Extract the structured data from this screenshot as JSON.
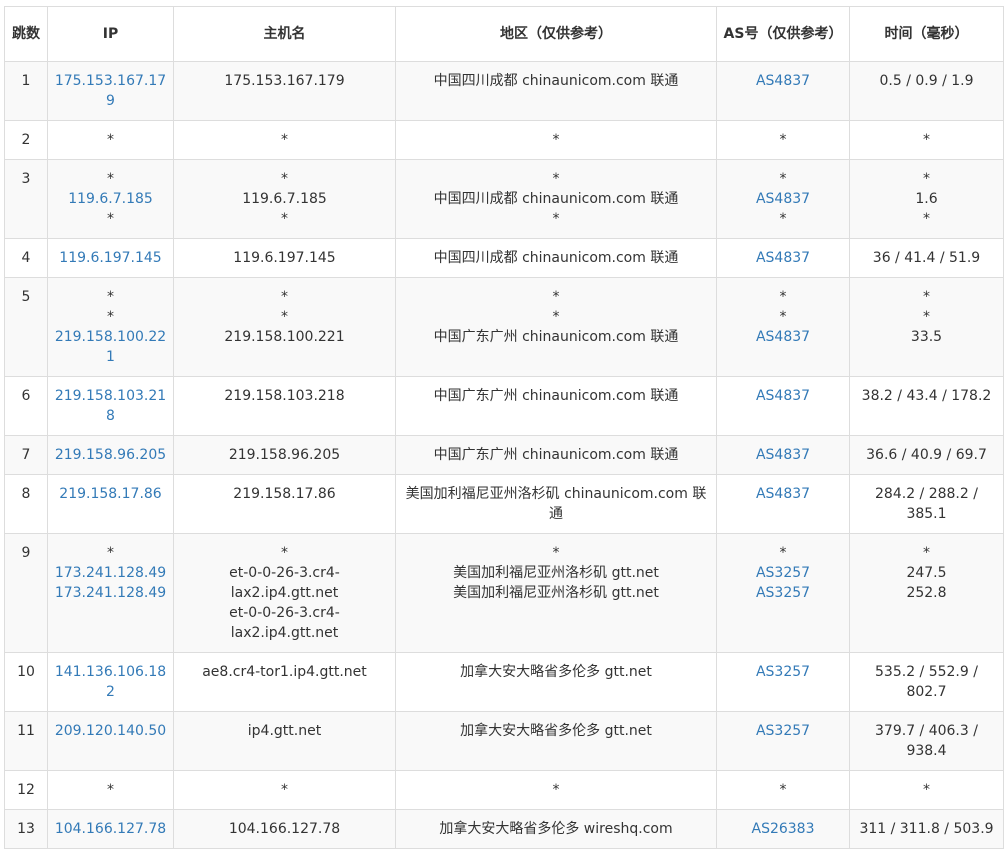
{
  "headers": [
    "跳数",
    "IP",
    "主机名",
    "地区（仅供参考）",
    "AS号（仅供参考）",
    "时间（毫秒）"
  ],
  "rows": [
    {
      "hop": "1",
      "ip": [
        "175.153.167.179"
      ],
      "host": [
        "175.153.167.179"
      ],
      "region": [
        "中国四川成都 chinaunicom.com 联通"
      ],
      "as": [
        "AS4837"
      ],
      "time": [
        "0.5 / 0.9 / 1.9"
      ]
    },
    {
      "hop": "2",
      "ip": [
        "*"
      ],
      "host": [
        "*"
      ],
      "region": [
        "*"
      ],
      "as": [
        "*"
      ],
      "time": [
        "*"
      ]
    },
    {
      "hop": "3",
      "ip": [
        "*",
        "119.6.7.185",
        "*"
      ],
      "host": [
        "*",
        "119.6.7.185",
        "*"
      ],
      "region": [
        "*",
        "中国四川成都 chinaunicom.com 联通",
        "*"
      ],
      "as": [
        "*",
        "AS4837",
        "*"
      ],
      "time": [
        "*",
        "1.6",
        "*"
      ]
    },
    {
      "hop": "4",
      "ip": [
        "119.6.197.145"
      ],
      "host": [
        "119.6.197.145"
      ],
      "region": [
        "中国四川成都 chinaunicom.com 联通"
      ],
      "as": [
        "AS4837"
      ],
      "time": [
        "36 / 41.4 / 51.9"
      ]
    },
    {
      "hop": "5",
      "ip": [
        "*",
        "*",
        "219.158.100.221"
      ],
      "host": [
        "*",
        "*",
        "219.158.100.221"
      ],
      "region": [
        "*",
        "*",
        "中国广东广州 chinaunicom.com 联通"
      ],
      "as": [
        "*",
        "*",
        "AS4837"
      ],
      "time": [
        "*",
        "*",
        "33.5"
      ]
    },
    {
      "hop": "6",
      "ip": [
        "219.158.103.218"
      ],
      "host": [
        "219.158.103.218"
      ],
      "region": [
        "中国广东广州 chinaunicom.com 联通"
      ],
      "as": [
        "AS4837"
      ],
      "time": [
        "38.2 / 43.4 / 178.2"
      ]
    },
    {
      "hop": "7",
      "ip": [
        "219.158.96.205"
      ],
      "host": [
        "219.158.96.205"
      ],
      "region": [
        "中国广东广州 chinaunicom.com 联通"
      ],
      "as": [
        "AS4837"
      ],
      "time": [
        "36.6 / 40.9 / 69.7"
      ]
    },
    {
      "hop": "8",
      "ip": [
        "219.158.17.86"
      ],
      "host": [
        "219.158.17.86"
      ],
      "region": [
        "美国加利福尼亚州洛杉矶 chinaunicom.com 联通"
      ],
      "as": [
        "AS4837"
      ],
      "time": [
        "284.2 / 288.2 / 385.1"
      ]
    },
    {
      "hop": "9",
      "ip": [
        "*",
        "173.241.128.49",
        "173.241.128.49"
      ],
      "host": [
        "*",
        "et-0-0-26-3.cr4-lax2.ip4.gtt.net",
        "et-0-0-26-3.cr4-lax2.ip4.gtt.net"
      ],
      "region": [
        "*",
        "美国加利福尼亚州洛杉矶 gtt.net",
        "美国加利福尼亚州洛杉矶 gtt.net"
      ],
      "as": [
        "*",
        "AS3257",
        "AS3257"
      ],
      "time": [
        "*",
        "247.5",
        "252.8"
      ]
    },
    {
      "hop": "10",
      "ip": [
        "141.136.106.182"
      ],
      "host": [
        "ae8.cr4-tor1.ip4.gtt.net"
      ],
      "region": [
        "加拿大安大略省多伦多 gtt.net"
      ],
      "as": [
        "AS3257"
      ],
      "time": [
        "535.2 / 552.9 / 802.7"
      ]
    },
    {
      "hop": "11",
      "ip": [
        "209.120.140.50"
      ],
      "host": [
        "ip4.gtt.net"
      ],
      "region": [
        "加拿大安大略省多伦多 gtt.net"
      ],
      "as": [
        "AS3257"
      ],
      "time": [
        "379.7 / 406.3 / 938.4"
      ]
    },
    {
      "hop": "12",
      "ip": [
        "*"
      ],
      "host": [
        "*"
      ],
      "region": [
        "*"
      ],
      "as": [
        "*"
      ],
      "time": [
        "*"
      ]
    },
    {
      "hop": "13",
      "ip": [
        "104.166.127.78"
      ],
      "host": [
        "104.166.127.78"
      ],
      "region": [
        "加拿大安大略省多伦多 wireshq.com"
      ],
      "as": [
        "AS26383"
      ],
      "time": [
        "311 / 311.8 / 503.9"
      ]
    }
  ],
  "colors": {
    "link": "#337ab7",
    "text": "#333333",
    "border": "#dddddd",
    "stripe": "#f9f9f9"
  }
}
